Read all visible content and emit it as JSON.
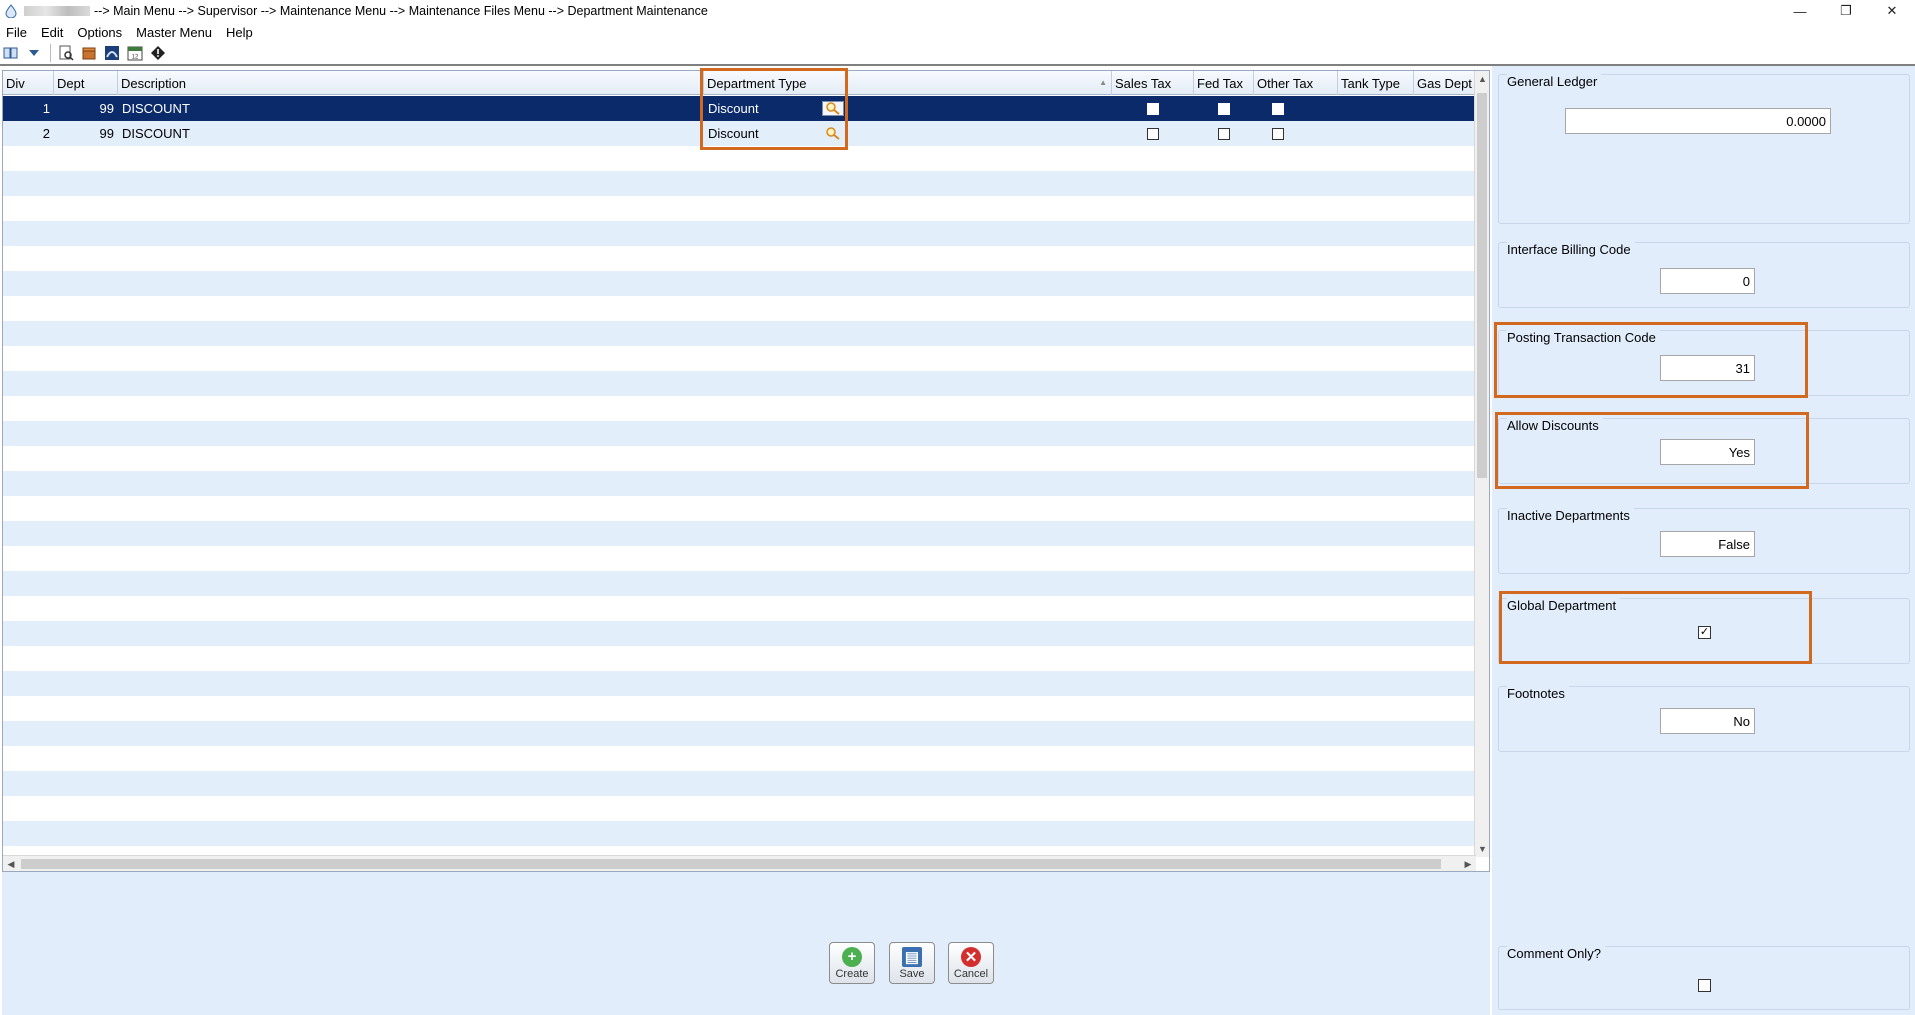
{
  "titlebar": {
    "path": "--> Main Menu --> Supervisor --> Maintenance Menu --> Maintenance Files Menu --> Department Maintenance",
    "minimize": "—",
    "restore": "❐",
    "close": "✕"
  },
  "menu": [
    "File",
    "Edit",
    "Options",
    "Master Menu",
    "Help"
  ],
  "grid": {
    "headers": {
      "div": "Div",
      "dept": "Dept",
      "description": "Description",
      "department_type": "Department Type",
      "sales_tax": "Sales  Tax",
      "fed_tax": "Fed  Tax",
      "other_tax": "Other  Tax",
      "tank_type": "Tank Type",
      "gas_dept": "Gas Dept"
    },
    "rows": [
      {
        "div": "1",
        "dept": "99",
        "description": "DISCOUNT",
        "department_type": "Discount"
      },
      {
        "div": "2",
        "dept": "99",
        "description": "DISCOUNT",
        "department_type": "Discount"
      }
    ]
  },
  "panel": {
    "general_ledger": {
      "label": "General Ledger",
      "value": "0.0000"
    },
    "interface_billing_code": {
      "label": "Interface Billing Code",
      "value": "0"
    },
    "posting_transaction_code": {
      "label": "Posting Transaction Code",
      "value": "31"
    },
    "allow_discounts": {
      "label": "Allow Discounts",
      "value": "Yes"
    },
    "inactive_departments": {
      "label": "Inactive Departments",
      "value": "False"
    },
    "global_department": {
      "label": "Global Department",
      "checked": true,
      "check_mark": "✓"
    },
    "footnotes": {
      "label": "Footnotes",
      "value": "No"
    },
    "comment_only": {
      "label": "Comment Only?",
      "checked": false
    }
  },
  "buttons": {
    "create": "Create",
    "save": "Save",
    "cancel": "Cancel"
  },
  "colors": {
    "highlight": "#d2691e",
    "selected_row": "#0b2a69",
    "panel_bg": "#e2edfb"
  }
}
